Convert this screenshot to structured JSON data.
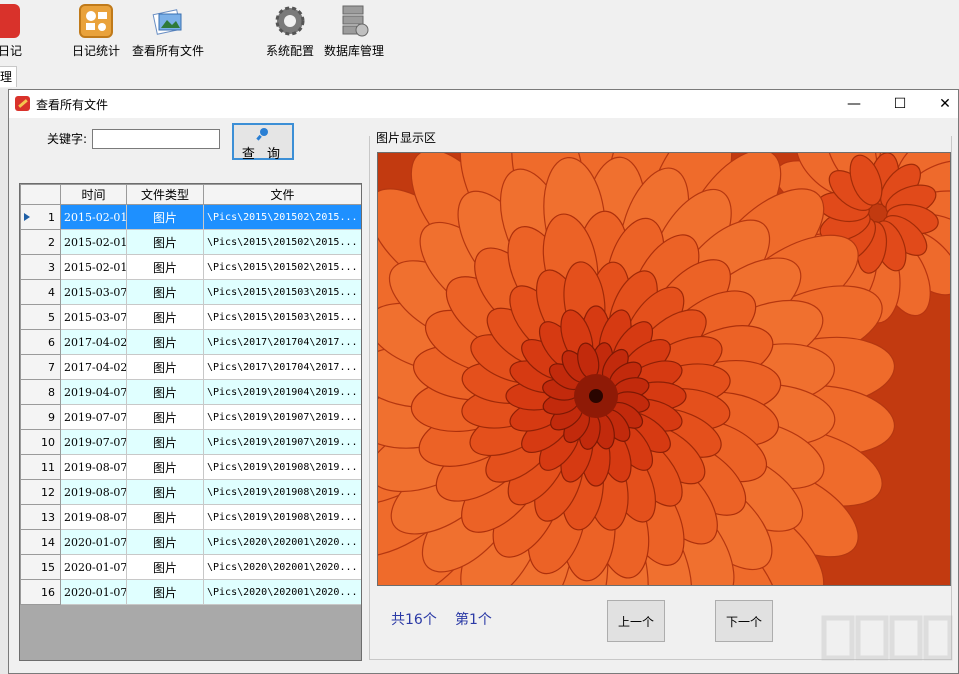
{
  "app": {
    "toolbar": [
      {
        "label": "日记",
        "icon": "diary-icon"
      },
      {
        "label": "日记统计",
        "icon": "stats-icon"
      },
      {
        "label": "查看所有文件",
        "icon": "files-icon"
      },
      {
        "label": "系统配置",
        "icon": "gear-icon"
      },
      {
        "label": "数据库管理",
        "icon": "database-icon"
      }
    ],
    "tab_label": "理"
  },
  "dialog": {
    "title": "查看所有文件",
    "controls": {
      "minimize": "—",
      "maximize": "☐",
      "close": "✕"
    },
    "keyword_label": "关键字:",
    "keyword_value": "",
    "query_label": "查 询",
    "grid": {
      "headers": [
        "",
        "时间",
        "文件类型",
        "文件"
      ],
      "rows": [
        {
          "n": "1",
          "date": "2015-02-01",
          "type": "图片",
          "path": "\\Pics\\2015\\201502\\2015..."
        },
        {
          "n": "2",
          "date": "2015-02-01",
          "type": "图片",
          "path": "\\Pics\\2015\\201502\\2015..."
        },
        {
          "n": "3",
          "date": "2015-02-01",
          "type": "图片",
          "path": "\\Pics\\2015\\201502\\2015..."
        },
        {
          "n": "4",
          "date": "2015-03-07",
          "type": "图片",
          "path": "\\Pics\\2015\\201503\\2015..."
        },
        {
          "n": "5",
          "date": "2015-03-07",
          "type": "图片",
          "path": "\\Pics\\2015\\201503\\2015..."
        },
        {
          "n": "6",
          "date": "2017-04-02",
          "type": "图片",
          "path": "\\Pics\\2017\\201704\\2017..."
        },
        {
          "n": "7",
          "date": "2017-04-02",
          "type": "图片",
          "path": "\\Pics\\2017\\201704\\2017..."
        },
        {
          "n": "8",
          "date": "2019-04-07",
          "type": "图片",
          "path": "\\Pics\\2019\\201904\\2019..."
        },
        {
          "n": "9",
          "date": "2019-07-07",
          "type": "图片",
          "path": "\\Pics\\2019\\201907\\2019..."
        },
        {
          "n": "10",
          "date": "2019-07-07",
          "type": "图片",
          "path": "\\Pics\\2019\\201907\\2019..."
        },
        {
          "n": "11",
          "date": "2019-08-07",
          "type": "图片",
          "path": "\\Pics\\2019\\201908\\2019..."
        },
        {
          "n": "12",
          "date": "2019-08-07",
          "type": "图片",
          "path": "\\Pics\\2019\\201908\\2019..."
        },
        {
          "n": "13",
          "date": "2019-08-07",
          "type": "图片",
          "path": "\\Pics\\2019\\201908\\2019..."
        },
        {
          "n": "14",
          "date": "2020-01-07",
          "type": "图片",
          "path": "\\Pics\\2020\\202001\\2020..."
        },
        {
          "n": "15",
          "date": "2020-01-07",
          "type": "图片",
          "path": "\\Pics\\2020\\202001\\2020..."
        },
        {
          "n": "16",
          "date": "2020-01-07",
          "type": "图片",
          "path": "\\Pics\\2020\\202001\\2020..."
        }
      ],
      "selected_row": 1
    },
    "picture_group_label": "图片显示区",
    "total_label": "共16个",
    "index_label": "第1个",
    "prev_label": "上一个",
    "next_label": "下一个"
  },
  "colors": {
    "selection": "#1e90ff",
    "alt_row": "#e0ffff",
    "pager_text": "#2b3aa6",
    "focus_border": "#3c8fd6",
    "flower": "#e8501c"
  }
}
